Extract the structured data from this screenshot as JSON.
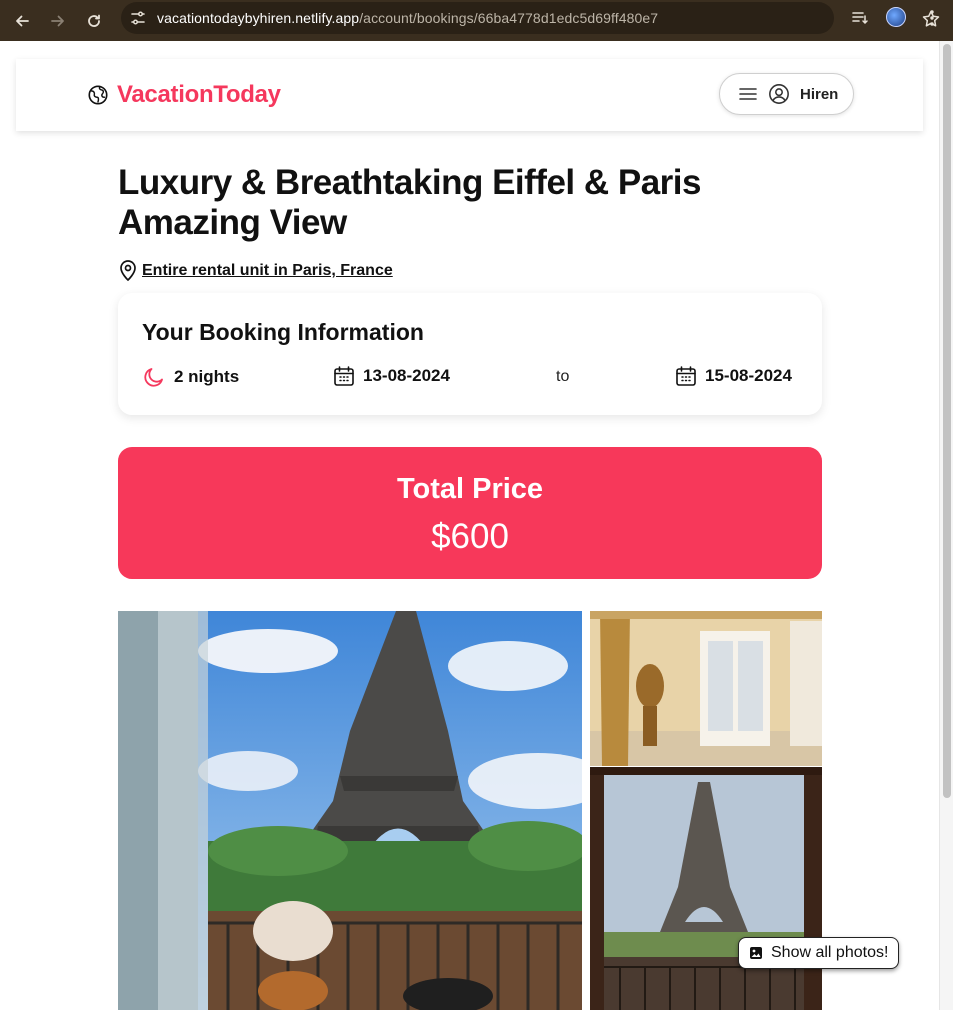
{
  "browser": {
    "url_host": "vacationtodaybyhiren.netlify.app",
    "url_path": "/account/bookings/66ba4778d1edc5d69ff480e7"
  },
  "header": {
    "logo_text": "VacationToday",
    "user_name": "Hiren"
  },
  "listing": {
    "title": "Luxury & Breathtaking Eiffel & Paris Amazing View",
    "location": "Entire rental unit in Paris, France"
  },
  "booking": {
    "heading": "Your Booking Information",
    "nights": "2 nights",
    "check_in": "13-08-2024",
    "separator": "to",
    "check_out": "15-08-2024"
  },
  "price": {
    "label": "Total Price",
    "value": "$600"
  },
  "photos": {
    "show_all_label": "Show all photos!"
  },
  "colors": {
    "brand": "#f5385d",
    "price_bg": "#f7385a"
  }
}
